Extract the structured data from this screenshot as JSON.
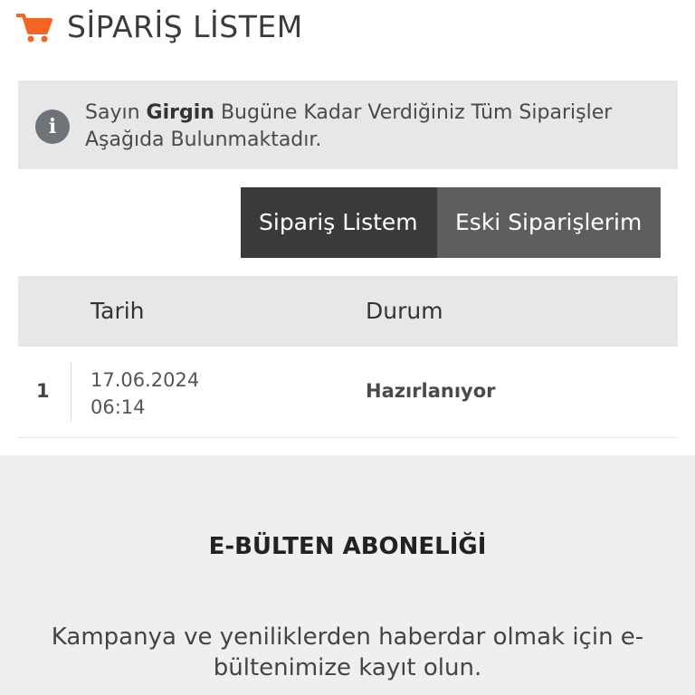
{
  "header": {
    "title": "SİPARİŞ LİSTEM",
    "icon": "shopping-cart-icon",
    "accent_color": "#f26522"
  },
  "info": {
    "icon": "info-icon",
    "greeting": "Sayın",
    "name": "Girgin",
    "message": "Bugüne Kadar Verdiğiniz Tüm Siparişler Aşağıda Bulunmaktadır."
  },
  "tabs": [
    {
      "label": "Sipariş Listem",
      "active": true
    },
    {
      "label": "Eski Siparişlerim",
      "active": false
    }
  ],
  "table": {
    "columns": [
      "Tarih",
      "Durum"
    ],
    "rows": [
      {
        "index": "1",
        "date": "17.06.2024",
        "time": "06:14",
        "status": "Hazırlanıyor"
      }
    ]
  },
  "newsletter": {
    "title": "E-BÜLTEN ABONELİĞİ",
    "text": "Kampanya ve yeniliklerden haberdar olmak için e-bültenimize kayıt olun."
  }
}
